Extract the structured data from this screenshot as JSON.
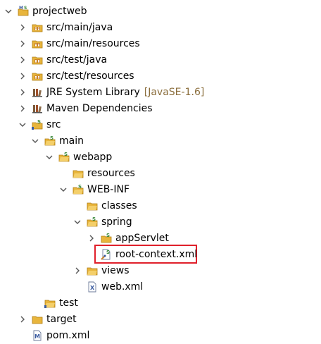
{
  "tree": {
    "project": {
      "label": "projectweb",
      "icon": "maven-project-icon"
    },
    "src_main_java": {
      "label": "src/main/java",
      "icon": "source-folder-icon"
    },
    "src_main_resources": {
      "label": "src/main/resources",
      "icon": "source-folder-icon"
    },
    "src_test_java": {
      "label": "src/test/java",
      "icon": "source-folder-icon"
    },
    "src_test_resources": {
      "label": "src/test/resources",
      "icon": "source-folder-icon"
    },
    "jre": {
      "label": "JRE System Library",
      "decoration": "[JavaSE-1.6]",
      "icon": "library-icon"
    },
    "maven_deps": {
      "label": "Maven Dependencies",
      "icon": "library-icon"
    },
    "src": {
      "label": "src",
      "icon": "spring-folder-icon"
    },
    "main": {
      "label": "main",
      "icon": "spring-folder-icon"
    },
    "webapp": {
      "label": "webapp",
      "icon": "spring-folder-icon"
    },
    "resources": {
      "label": "resources",
      "icon": "folder-icon"
    },
    "web_inf": {
      "label": "WEB-INF",
      "icon": "spring-folder-icon"
    },
    "classes": {
      "label": "classes",
      "icon": "folder-icon"
    },
    "spring": {
      "label": "spring",
      "icon": "spring-folder-icon"
    },
    "appservlet": {
      "label": "appServlet",
      "icon": "spring-folder-icon"
    },
    "root_context": {
      "label": "root-context.xml",
      "icon": "spring-xml-file-icon"
    },
    "views": {
      "label": "views",
      "icon": "folder-icon"
    },
    "web_xml": {
      "label": "web.xml",
      "icon": "xml-file-icon"
    },
    "test": {
      "label": "test",
      "icon": "folder-icon"
    },
    "target": {
      "label": "target",
      "icon": "folder-icon"
    },
    "pom": {
      "label": "pom.xml",
      "icon": "maven-file-icon"
    }
  },
  "colors": {
    "highlight_border": "#e0202b",
    "folder": "#e8b53c",
    "decoration_text": "#8a6d3b",
    "spring_green": "#3c8a3c"
  }
}
